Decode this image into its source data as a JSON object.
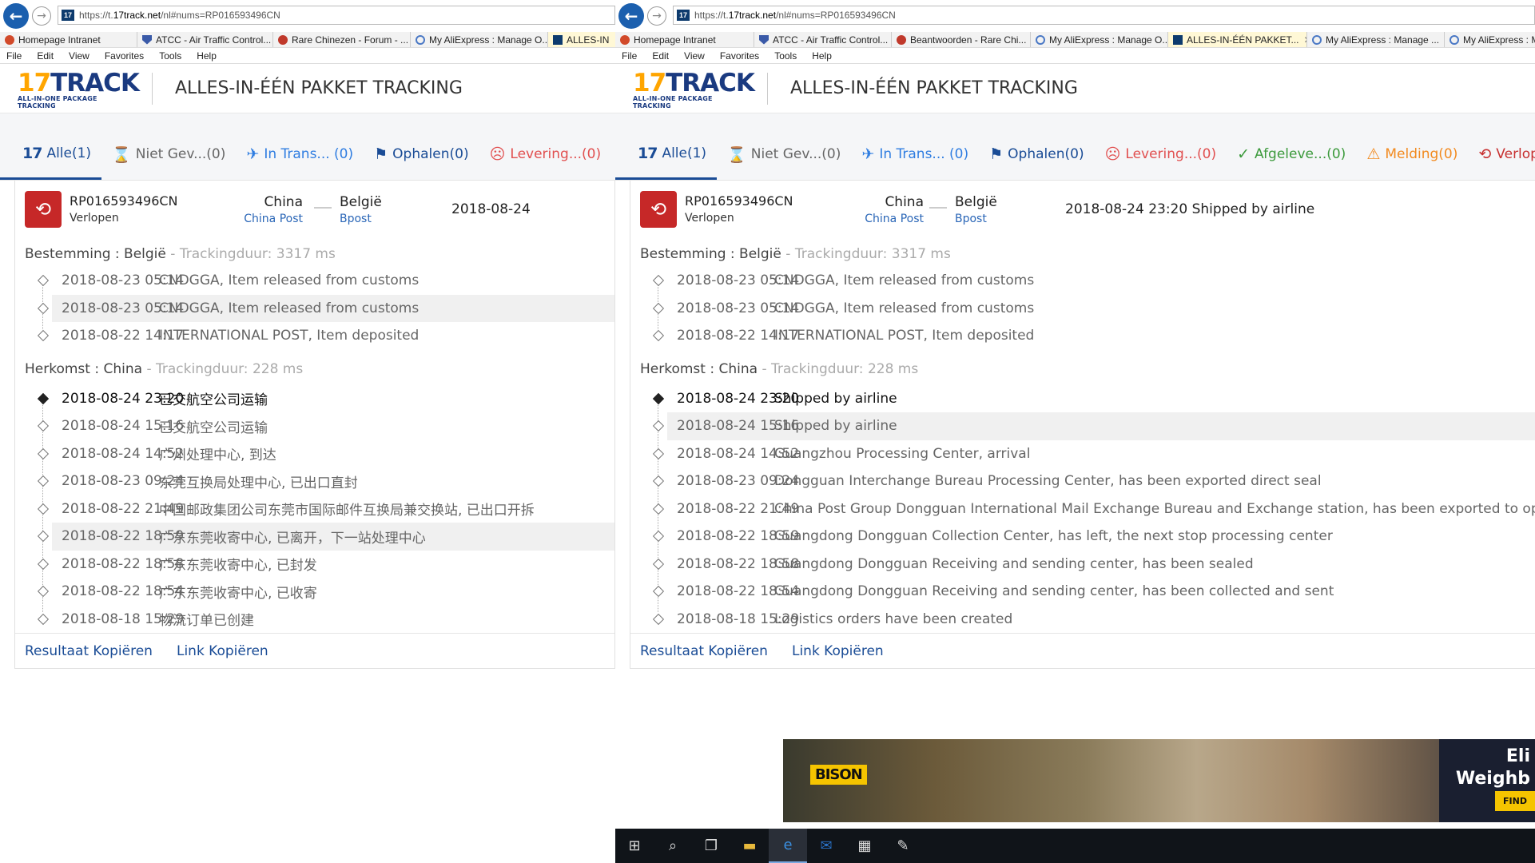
{
  "left": {
    "url_prefix": "https://t.",
    "url_host": "17track.net",
    "url_rest": "/nl#nums=RP016593496CN",
    "tabs": [
      {
        "label": "Homepage Intranet",
        "icon": "home-icon"
      },
      {
        "label": "ATCC - Air Traffic Control...",
        "icon": "shield-icon"
      },
      {
        "label": "Rare Chinezen - Forum - ...",
        "icon": "bug-icon"
      },
      {
        "label": "My AliExpress : Manage O...",
        "icon": "globe-icon"
      },
      {
        "label": "ALLES-IN",
        "icon": "17track-icon"
      }
    ],
    "latest_date": "2018-08-24",
    "destination_events": [
      {
        "time": "2018-08-23 05:14",
        "desc": "CNDGGA, Item released from customs"
      },
      {
        "time": "2018-08-23 05:14",
        "desc": "CNDGGA, Item released from customs"
      },
      {
        "time": "2018-08-22 14:17",
        "desc": "INTERNATIONAL POST, Item deposited"
      }
    ],
    "origin_events": [
      {
        "time": "2018-08-24 23:20",
        "desc": "已交航空公司运输"
      },
      {
        "time": "2018-08-24 15:16",
        "desc": "已交航空公司运输"
      },
      {
        "time": "2018-08-24 14:52",
        "desc": "广州处理中心, 到达"
      },
      {
        "time": "2018-08-23 09:24",
        "desc": "东莞互换局处理中心, 已出口直封"
      },
      {
        "time": "2018-08-22 21:49",
        "desc": "中国邮政集团公司东莞市国际邮件互换局兼交换站, 已出口开拆"
      },
      {
        "time": "2018-08-22 18:59",
        "desc": "广东东莞收寄中心, 已离开，下一站处理中心"
      },
      {
        "time": "2018-08-22 18:58",
        "desc": "广东东莞收寄中心, 已封发"
      },
      {
        "time": "2018-08-22 18:54",
        "desc": "广东东莞收寄中心, 已收寄"
      },
      {
        "time": "2018-08-18 15:29",
        "desc": "物流订单已创建"
      }
    ]
  },
  "right": {
    "url_prefix": "https://t.",
    "url_host": "17track.net",
    "url_rest": "/nl#nums=RP016593496CN",
    "tabs": [
      {
        "label": "Homepage Intranet",
        "icon": "home-icon"
      },
      {
        "label": "ATCC - Air Traffic Control...",
        "icon": "shield-icon"
      },
      {
        "label": "Beantwoorden - Rare Chi...",
        "icon": "bug-icon"
      },
      {
        "label": "My AliExpress : Manage O...",
        "icon": "globe-icon"
      },
      {
        "label": "ALLES-IN-ÉÉN PAKKET...",
        "icon": "17track-icon"
      },
      {
        "label": "My AliExpress : Manage ...",
        "icon": "globe-icon"
      },
      {
        "label": "My AliExpress : M",
        "icon": "globe-icon"
      }
    ],
    "latest_date": "2018-08-24 23:20",
    "latest_desc": "Shipped by airline",
    "destination_events": [
      {
        "time": "2018-08-23 05:14",
        "desc": "CNDGGA, Item released from customs"
      },
      {
        "time": "2018-08-23 05:14",
        "desc": "CNDGGA, Item released from customs"
      },
      {
        "time": "2018-08-22 14:17",
        "desc": "INTERNATIONAL POST, Item deposited"
      }
    ],
    "origin_events": [
      {
        "time": "2018-08-24 23:20",
        "desc": "Shipped by airline"
      },
      {
        "time": "2018-08-24 15:16",
        "desc": "Shipped by airline"
      },
      {
        "time": "2018-08-24 14:52",
        "desc": "Guangzhou Processing Center, arrival"
      },
      {
        "time": "2018-08-23 09:24",
        "desc": "Dongguan Interchange Bureau Processing Center, has been exported direct seal"
      },
      {
        "time": "2018-08-22 21:49",
        "desc": "China Post Group Dongguan International Mail Exchange Bureau and Exchange station, has been exported to open and"
      },
      {
        "time": "2018-08-22 18:59",
        "desc": "Guangdong Dongguan Collection Center, has left, the next stop processing center"
      },
      {
        "time": "2018-08-22 18:58",
        "desc": "Guangdong Dongguan Receiving and sending center, has been sealed"
      },
      {
        "time": "2018-08-22 18:54",
        "desc": "Guangdong Dongguan Receiving and sending center, has been collected and sent"
      },
      {
        "time": "2018-08-18 15:29",
        "desc": "Logistics orders have been created"
      }
    ],
    "ad": {
      "brand": "BISON",
      "text_line1": "Eli",
      "text_line2": "Weighb",
      "button": "FIND"
    }
  },
  "menu": [
    "File",
    "Edit",
    "View",
    "Favorites",
    "Tools",
    "Help"
  ],
  "logo": {
    "num": "17",
    "word": "TRACK",
    "sub": "ALL-IN-ONE PACKAGE TRACKING"
  },
  "page_title": "ALLES-IN-ÉÉN PAKKET TRACKING",
  "filters": {
    "alle": "Alle(1)",
    "niet": "Niet Gev...(0)",
    "trans": "In Trans... (0)",
    "ophalen": "Ophalen(0)",
    "levering": "Levering...(0)",
    "afgel": "Afgeleve...(0)",
    "melding": "Melding(0)",
    "verlopen": "Verlopen("
  },
  "package": {
    "number": "RP016593496CN",
    "status": "Verlopen",
    "origin": "China",
    "origin_carrier": "China Post",
    "destination": "België",
    "destination_carrier": "Bpost"
  },
  "dest_section": {
    "label": "Bestemming : België",
    "duration": " - Trackingduur: 3317 ms"
  },
  "orig_section": {
    "label": "Herkomst : China",
    "duration": " - Trackingduur: 228 ms"
  },
  "footer": {
    "copy_result": "Resultaat Kopiëren",
    "copy_link": "Link Kopiëren"
  },
  "colors": {
    "brand_blue": "#1a4c96",
    "expired_red": "#c62828",
    "logo_orange": "#ffa500"
  }
}
